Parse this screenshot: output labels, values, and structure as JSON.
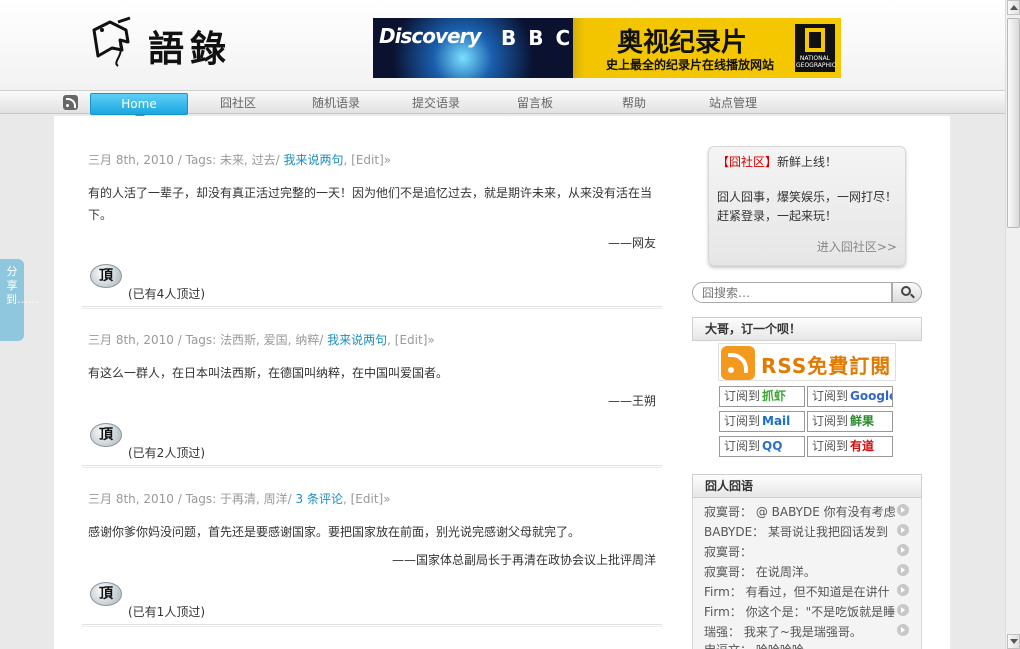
{
  "site": {
    "logo_text": "語錄"
  },
  "banner": {
    "discovery": "Discovery",
    "bbc": "BBC",
    "title": "奥视纪录片",
    "subtitle": "史上最全的纪录片在线播放网站",
    "ng_text": "NATIONAL GEOGRAPHIC"
  },
  "nav": {
    "items": [
      {
        "label": "Home"
      },
      {
        "label": "囧社区"
      },
      {
        "label": "随机语录"
      },
      {
        "label": "提交语录"
      },
      {
        "label": "留言板"
      },
      {
        "label": "帮助"
      },
      {
        "label": "站点管理"
      }
    ]
  },
  "posts": [
    {
      "date_tags": "三月 8th, 2010 / Tags: 未来, 过去/ ",
      "comment_link": "我来说两句",
      "edit": ", [Edit]»",
      "body": "有的人活了一辈子，却没有真正活过完整的一天！因为他们不是追忆过去，就是期许未来，从来没有活在当下。",
      "author": "——网友",
      "ding_label": "頂",
      "ding_count": "(已有4人顶过)"
    },
    {
      "date_tags": "三月 8th, 2010 / Tags: 法西斯, 爱国, 纳粹/ ",
      "comment_link": "我来说两句",
      "edit": ", [Edit]»",
      "body": "有这么一群人，在日本叫法西斯，在德国叫纳粹，在中国叫爱国者。",
      "author": "——王朔",
      "ding_label": "頂",
      "ding_count": "(已有2人顶过)"
    },
    {
      "date_tags": "三月 8th, 2010 / Tags: 于再清, 周洋/ ",
      "comment_link": "3 条评论",
      "edit": ", [Edit]»",
      "body": "感谢你爹你妈没问题，首先还是要感谢国家。要把国家放在前面，别光说完感谢父母就完了。",
      "author": "——国家体总副局长于再清在政协会议上批评周洋",
      "ding_label": "頂",
      "ding_count": "(已有1人顶过)"
    }
  ],
  "sidebar": {
    "community": {
      "bracket": "【囧社区】",
      "headline": "新鲜上线！",
      "line1": "囧人囧事，爆笑娱乐，一网打尽！",
      "line2": "赶紧登录，一起来玩！",
      "more": "进入囧社区>>"
    },
    "search": {
      "placeholder": "囧搜索…"
    },
    "subscribe": {
      "title": "大哥，订一个呗！",
      "rss_text": "RSS免費訂閱",
      "buttons": [
        {
          "prefix": "订阅到",
          "brand": "抓虾",
          "color": "#3aa832"
        },
        {
          "prefix": "订阅到",
          "brand": "Google",
          "color": "#3366cc"
        },
        {
          "prefix": "订阅到",
          "brand": "Mail",
          "color": "#1a6fc9"
        },
        {
          "prefix": "订阅到",
          "brand": "鲜果",
          "color": "#2a8a2a"
        },
        {
          "prefix": "订阅到",
          "brand": "QQ",
          "color": "#2a6fc9"
        },
        {
          "prefix": "订阅到",
          "brand": "有道",
          "color": "#d01010"
        }
      ]
    },
    "messages": {
      "title": "囧人囧语",
      "items": [
        "寂寞哥： @ BABYDE 你有没有考虑",
        "BABYDE： 某哥说让我把囧话发到",
        "寂寞哥：",
        "寂寞哥： 在说周洋。",
        "Firm： 有看过，但不知道是在讲什",
        "Firm： 你这个是：\"不是吃饭就是睡",
        "瑞强： 我来了~我是瑞强哥。",
        "申逗文： 哈哈哈哈"
      ]
    }
  },
  "share_tab": "分享到……"
}
